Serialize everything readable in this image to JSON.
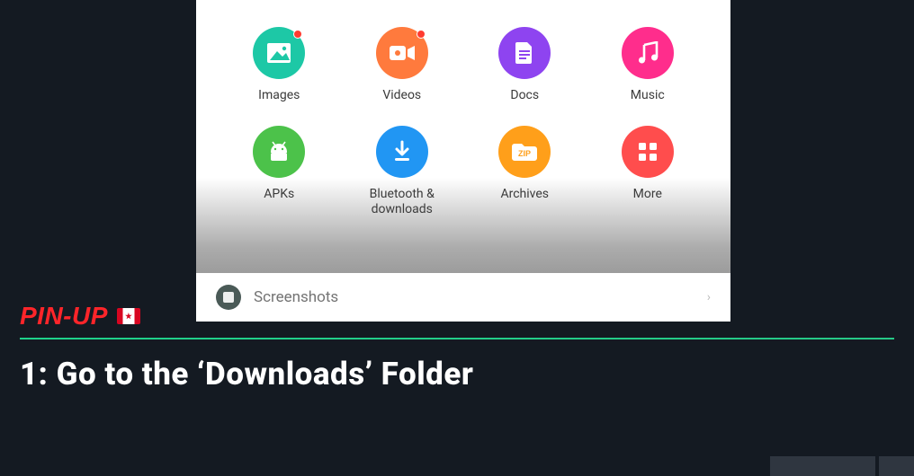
{
  "brand": {
    "name": "PIN-UP",
    "flag": "canada"
  },
  "headline": "1: Go to the ‘Downloads’ Folder",
  "categories": [
    {
      "key": "images",
      "label": "Images",
      "color": "teal",
      "icon": "image-icon",
      "notif": true
    },
    {
      "key": "videos",
      "label": "Videos",
      "color": "orange",
      "icon": "video-icon",
      "notif": true
    },
    {
      "key": "docs",
      "label": "Docs",
      "color": "purple",
      "icon": "doc-icon",
      "notif": false
    },
    {
      "key": "music",
      "label": "Music",
      "color": "pink",
      "icon": "music-icon",
      "notif": false
    },
    {
      "key": "apks",
      "label": "APKs",
      "color": "green",
      "icon": "android-icon",
      "notif": false
    },
    {
      "key": "downloads",
      "label": "Bluetooth & downloads",
      "color": "blue",
      "icon": "download-icon",
      "notif": false
    },
    {
      "key": "archives",
      "label": "Archives",
      "color": "amber",
      "icon": "zip-icon",
      "notif": false
    },
    {
      "key": "more",
      "label": "More",
      "color": "red",
      "icon": "grid-icon",
      "notif": false
    }
  ],
  "screenshots_row": {
    "label": "Screenshots"
  }
}
